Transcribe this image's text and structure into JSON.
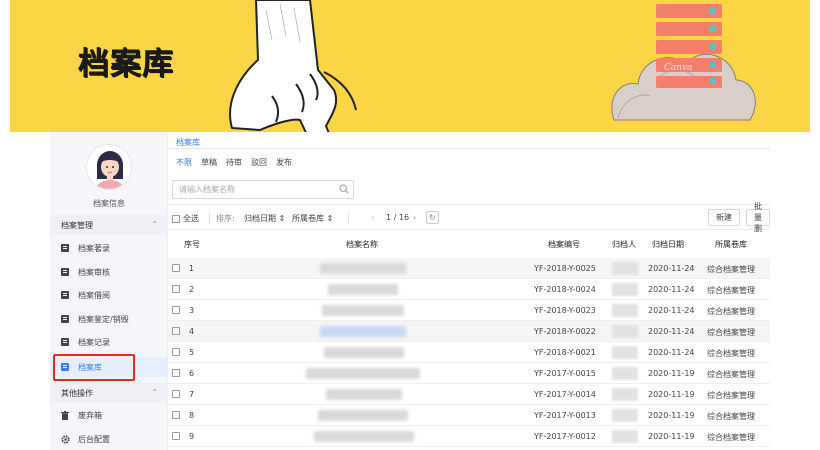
{
  "banner": {
    "title": "档案库",
    "logo_text": "Canva"
  },
  "sidebar": {
    "profile_label": "档案信息",
    "groups": [
      {
        "label": "档案管理",
        "chevron": "⌃"
      },
      {
        "label": "其他操作",
        "chevron": "⌃"
      }
    ],
    "items": [
      {
        "label": "档案著录"
      },
      {
        "label": "档案审核"
      },
      {
        "label": "档案借阅"
      },
      {
        "label": "档案鉴定/销毁"
      },
      {
        "label": "档案记录"
      },
      {
        "label": "档案库"
      },
      {
        "label": "废弃箱"
      },
      {
        "label": "后台配置"
      }
    ]
  },
  "main": {
    "breadcrumb": "档案库",
    "status_tabs": [
      "不限",
      "草稿",
      "待审",
      "驳回",
      "发布"
    ],
    "search": {
      "placeholder": "请输入档案名称",
      "value": ""
    },
    "toolbar": {
      "select_all": "全选",
      "sort_label": "排序:",
      "sort_field": "归档日期 ⇕",
      "filter_field": "所属卷库 ⇕",
      "pager": "1 / 16",
      "new_button": "新建",
      "batch_button": "批量删"
    },
    "table": {
      "headers": [
        "序号",
        "档案名称",
        "档案编号",
        "归档人",
        "归档日期",
        "所属卷库"
      ],
      "rows": [
        {
          "index": "1",
          "code": "YF-2018-Y-0025",
          "date": "2020-11-24",
          "library": "综合档案管理"
        },
        {
          "index": "2",
          "code": "YF-2018-Y-0024",
          "date": "2020-11-24",
          "library": "综合档案管理"
        },
        {
          "index": "3",
          "code": "YF-2018-Y-0023",
          "date": "2020-11-24",
          "library": "综合档案管理"
        },
        {
          "index": "4",
          "code": "YF-2018-Y-0022",
          "date": "2020-11-24",
          "library": "综合档案管理"
        },
        {
          "index": "5",
          "code": "YF-2018-Y-0021",
          "date": "2020-11-24",
          "library": "综合档案管理"
        },
        {
          "index": "6",
          "code": "YF-2017-Y-0015",
          "date": "2020-11-19",
          "library": "综合档案管理"
        },
        {
          "index": "7",
          "code": "YF-2017-Y-0014",
          "date": "2020-11-19",
          "library": "综合档案管理"
        },
        {
          "index": "8",
          "code": "YF-2017-Y-0013",
          "date": "2020-11-19",
          "library": "综合档案管理"
        },
        {
          "index": "9",
          "code": "YF-2017-Y-0012",
          "date": "2020-11-19",
          "library": "综合档案管理"
        }
      ]
    }
  },
  "colors": {
    "banner": "#fad546",
    "accent": "#3a7bf0",
    "highlight": "#e6281e",
    "server": "#f47f6a"
  }
}
